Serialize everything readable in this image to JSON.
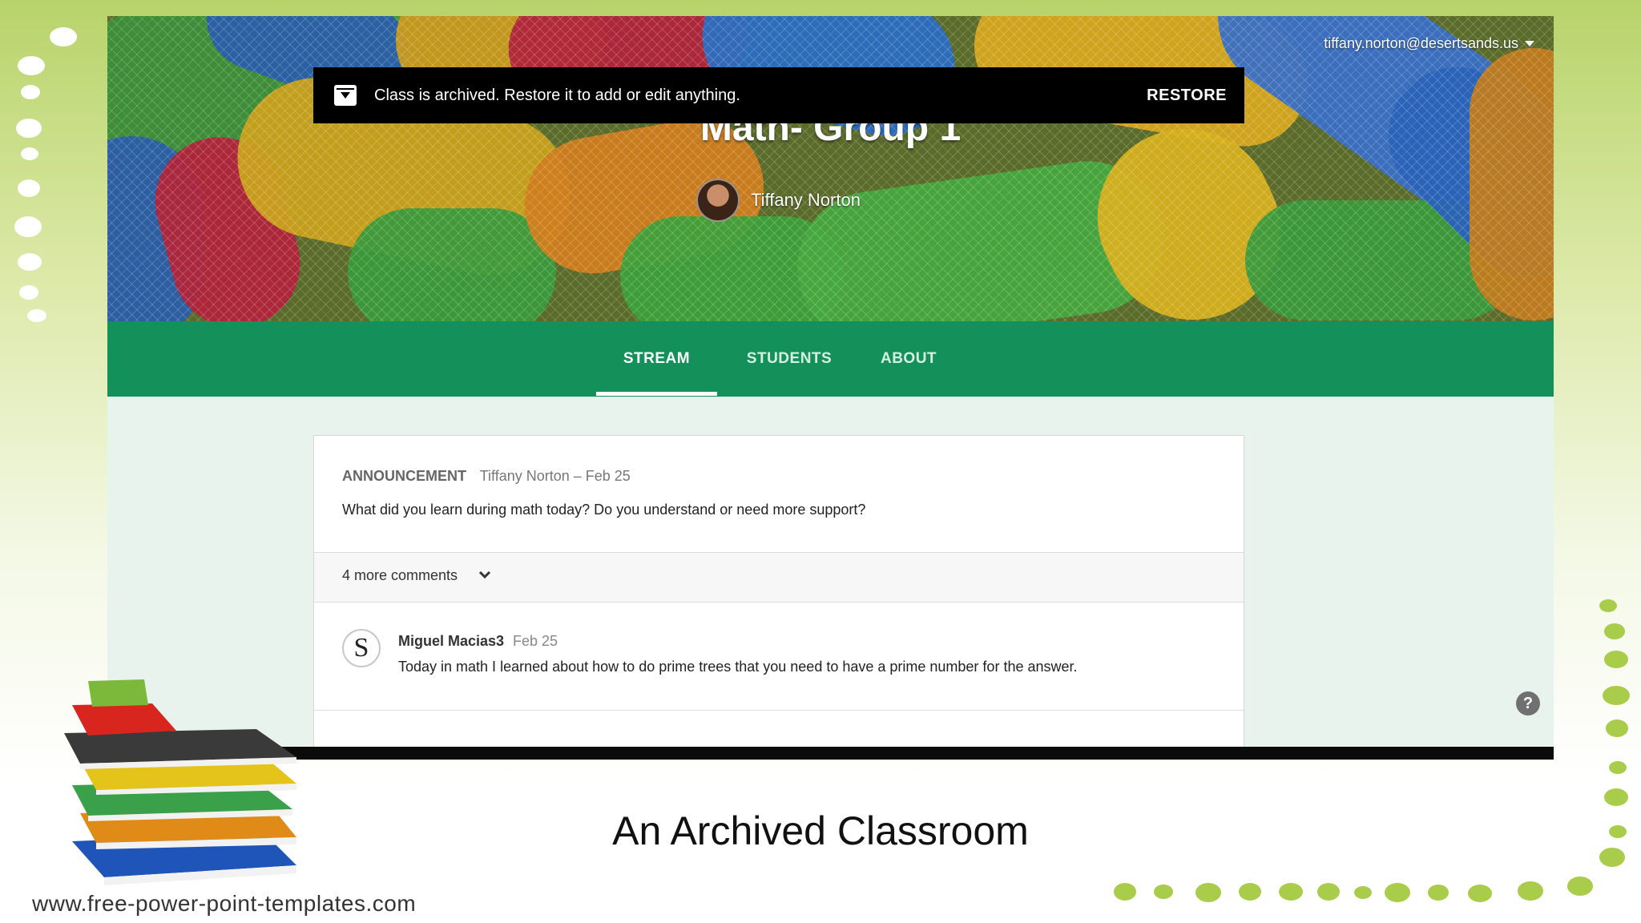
{
  "account": {
    "email": "tiffany.norton@desertsands.us"
  },
  "class": {
    "title": "Math- Group 1",
    "teacher": "Tiffany Norton"
  },
  "archive_notice": {
    "message": "Class is archived. Restore it to add or edit anything.",
    "action": "RESTORE"
  },
  "tabs": [
    {
      "label": "STREAM",
      "active": true
    },
    {
      "label": "STUDENTS",
      "active": false
    },
    {
      "label": "ABOUT",
      "active": false
    }
  ],
  "post": {
    "type": "ANNOUNCEMENT",
    "meta": "Tiffany Norton – Feb 25",
    "text": "What did you learn during math today? Do you understand or need more support?",
    "comments_toggle": "4 more comments"
  },
  "comment": {
    "author": "Miguel Macias3",
    "date": "Feb 25",
    "text": "Today in math I learned about how to do prime trees that you need to have a prime number for the answer.",
    "avatar_letter": "S"
  },
  "help": "?",
  "slide": {
    "caption": "An Archived Classroom",
    "footer": "www.free-power-point-templates.com"
  },
  "colors": {
    "nav_green": "#14905a",
    "slide_accent": "#a9cc4a"
  }
}
